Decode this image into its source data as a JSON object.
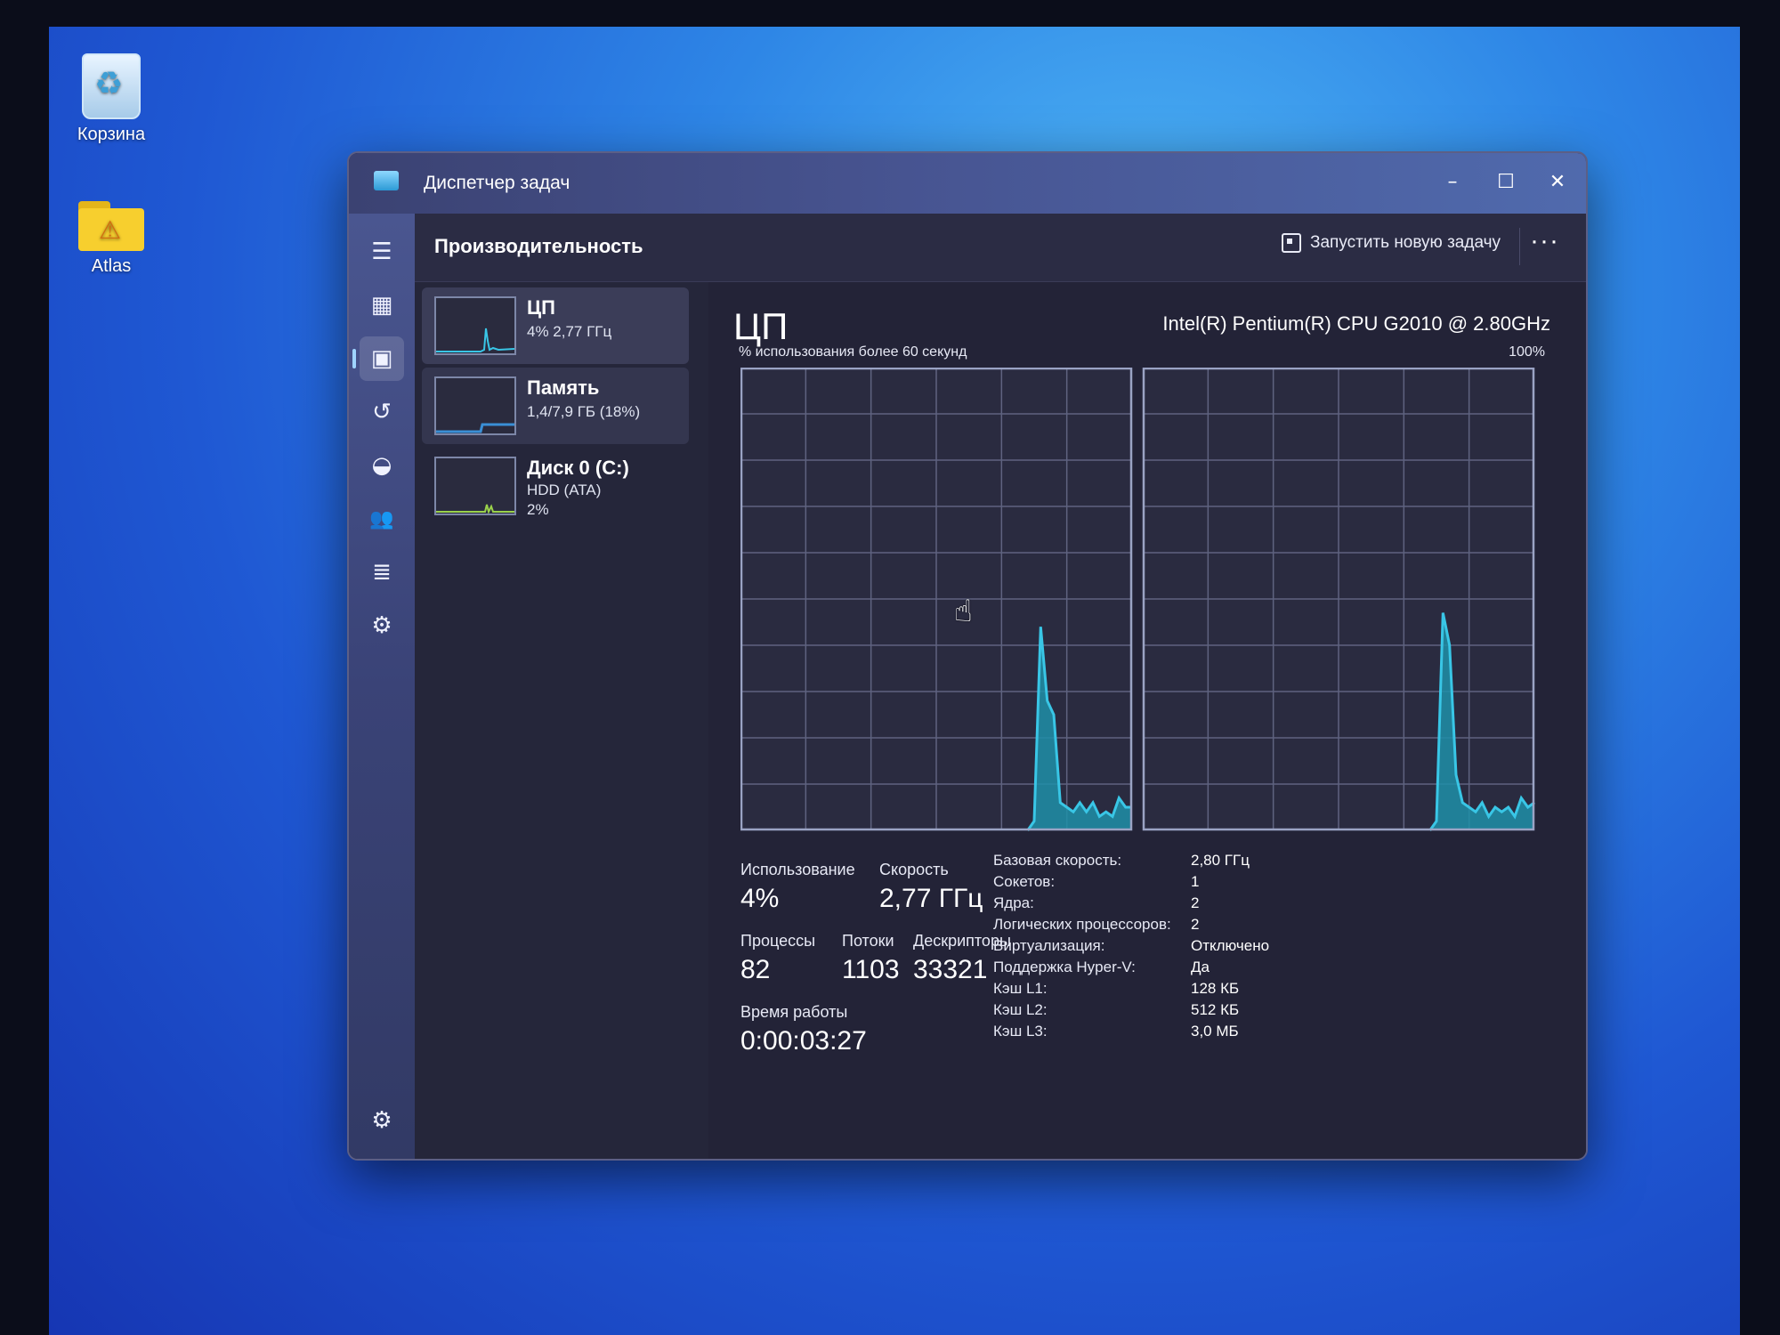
{
  "desktop": {
    "icons": [
      {
        "label": "Корзина",
        "icon": "recycle-bin-icon"
      },
      {
        "label": "Atlas",
        "icon": "folder-icon"
      }
    ]
  },
  "window": {
    "title": "Диспетчер задач",
    "controls": {
      "minimize": "–",
      "maximize": "☐",
      "close": "✕"
    }
  },
  "nav": {
    "icons": [
      "menu-icon",
      "processes-icon",
      "performance-icon",
      "app-history-icon",
      "startup-icon",
      "users-icon",
      "details-icon",
      "services-icon",
      "settings-icon"
    ],
    "glyphs": {
      "menu": "☰",
      "processes": "▦",
      "performance": "▣",
      "history": "↺",
      "startup": "◒",
      "users": "👥",
      "details": "≣",
      "services": "⚙",
      "settings": "⚙"
    }
  },
  "header": {
    "title": "Производительность",
    "run_task": "Запустить новую задачу",
    "more": "···"
  },
  "sidebar": {
    "items": [
      {
        "title": "ЦП",
        "line1": "4% 2,77 ГГц",
        "line2": "",
        "selected": true
      },
      {
        "title": "Память",
        "line1": "1,4/7,9 ГБ (18%)",
        "line2": "",
        "selected": false
      },
      {
        "title": "Диск 0 (C:)",
        "line1": "HDD (ATA)",
        "line2": "2%",
        "selected": false
      }
    ]
  },
  "cpu": {
    "title": "ЦП",
    "model": "Intel(R) Pentium(R) CPU G2010 @ 2.80GHz",
    "graph_label": "% использования более 60 секунд",
    "graph_max": "100%",
    "colors": {
      "line": "#39c6e6",
      "fill": "#1f8fa8",
      "grid": "#5f6380",
      "border": "#9aa3c4"
    },
    "stats": {
      "usage_label": "Использование",
      "usage_value": "4%",
      "speed_label": "Скорость",
      "speed_value": "2,77 ГГц",
      "processes_label": "Процессы",
      "processes_value": "82",
      "threads_label": "Потоки",
      "threads_value": "1103",
      "handles_label": "Дескрипторы",
      "handles_value": "33321",
      "uptime_label": "Время работы",
      "uptime_value": "0:00:03:27"
    },
    "specs": [
      {
        "key": "Базовая скорость:",
        "value": "2,80 ГГц"
      },
      {
        "key": "Сокетов:",
        "value": "1"
      },
      {
        "key": "Ядра:",
        "value": "2"
      },
      {
        "key": "Логических процессоров:",
        "value": "2"
      },
      {
        "key": "Виртуализация:",
        "value": "Отключено"
      },
      {
        "key": "Поддержка Hyper-V:",
        "value": "Да"
      },
      {
        "key": "Кэш L1:",
        "value": "128 КБ"
      },
      {
        "key": "Кэш L2:",
        "value": "512 КБ"
      },
      {
        "key": "Кэш L3:",
        "value": "3,0 МБ"
      }
    ]
  },
  "chart_data": {
    "type": "area",
    "title": "",
    "xlabel": "% использования более 60 секунд",
    "ylabel": "",
    "ylim": [
      0,
      100
    ],
    "x": [
      0,
      2,
      4,
      6,
      8,
      10,
      12,
      14,
      16,
      18,
      20,
      22,
      24,
      26,
      28,
      30,
      32,
      34,
      36,
      38,
      40,
      42,
      44,
      46,
      48,
      50,
      52,
      54,
      56,
      58,
      60
    ],
    "series": [
      {
        "name": "",
        "values": [
          0,
          0,
          0,
          0,
          0,
          0,
          0,
          0,
          0,
          0,
          0,
          0,
          0,
          0,
          0,
          0,
          0,
          0,
          0,
          0,
          0,
          0,
          0,
          0,
          0,
          0,
          0,
          0,
          0,
          0,
          0
        ]
      },
      {
        "name": "",
        "values": [
          0,
          0,
          0,
          0,
          0,
          0,
          0,
          0,
          0,
          0,
          0,
          0,
          0,
          0,
          0,
          0,
          0,
          0,
          0,
          0,
          0,
          0,
          0,
          0,
          0,
          0,
          0,
          0,
          0,
          0,
          0
        ]
      }
    ],
    "spikes": [
      [
        [
          44,
          0
        ],
        [
          45,
          2
        ],
        [
          46,
          44
        ],
        [
          47,
          28
        ],
        [
          48,
          25
        ],
        [
          49,
          6
        ],
        [
          50,
          5
        ],
        [
          51,
          4
        ],
        [
          52,
          6
        ],
        [
          53,
          4
        ],
        [
          54,
          6
        ],
        [
          55,
          3
        ],
        [
          56,
          4
        ],
        [
          57,
          3
        ],
        [
          58,
          7
        ],
        [
          59,
          5
        ],
        [
          60,
          5
        ]
      ],
      [
        [
          44,
          0
        ],
        [
          45,
          2
        ],
        [
          46,
          47
        ],
        [
          47,
          40
        ],
        [
          48,
          12
        ],
        [
          49,
          6
        ],
        [
          50,
          5
        ],
        [
          51,
          4
        ],
        [
          52,
          6
        ],
        [
          53,
          3
        ],
        [
          54,
          5
        ],
        [
          55,
          4
        ],
        [
          56,
          5
        ],
        [
          57,
          3
        ],
        [
          58,
          7
        ],
        [
          59,
          5
        ],
        [
          60,
          6
        ]
      ]
    ]
  },
  "thumbs": {
    "cpu_color": "#39c6e6",
    "mem_color": "#3a8fd6",
    "disk_color": "#9ad14b"
  }
}
